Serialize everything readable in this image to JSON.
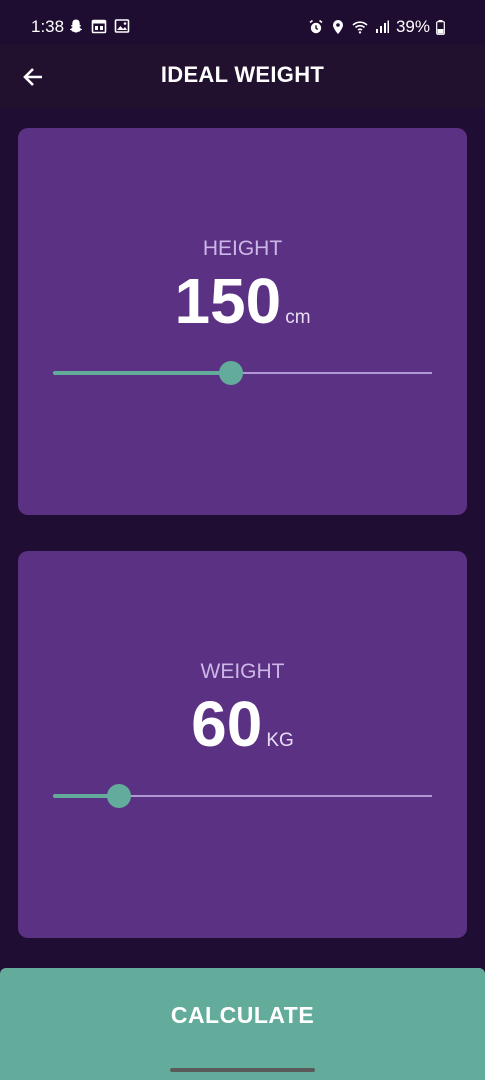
{
  "status_bar": {
    "time": "1:38",
    "battery": "39%"
  },
  "app_bar": {
    "title": "IDEAL WEIGHT"
  },
  "height_card": {
    "label": "HEIGHT",
    "value": "150",
    "unit": "cm",
    "slider_fraction": 0.47
  },
  "weight_card": {
    "label": "WEIGHT",
    "value": "60",
    "unit": "KG",
    "slider_fraction": 0.175
  },
  "actions": {
    "calculate_label": "CALCULATE"
  },
  "colors": {
    "background": "#200d33",
    "card": "#5b3183",
    "accent": "#63ac9b",
    "label": "#cdb7e6"
  },
  "icons": {
    "back": "arrow-left-icon",
    "status_left": [
      "snapchat-icon",
      "calendar-icon",
      "gallery-icon"
    ],
    "status_right": [
      "alarm-icon",
      "location-icon",
      "wifi-icon",
      "signal-icon",
      "battery-icon"
    ]
  }
}
